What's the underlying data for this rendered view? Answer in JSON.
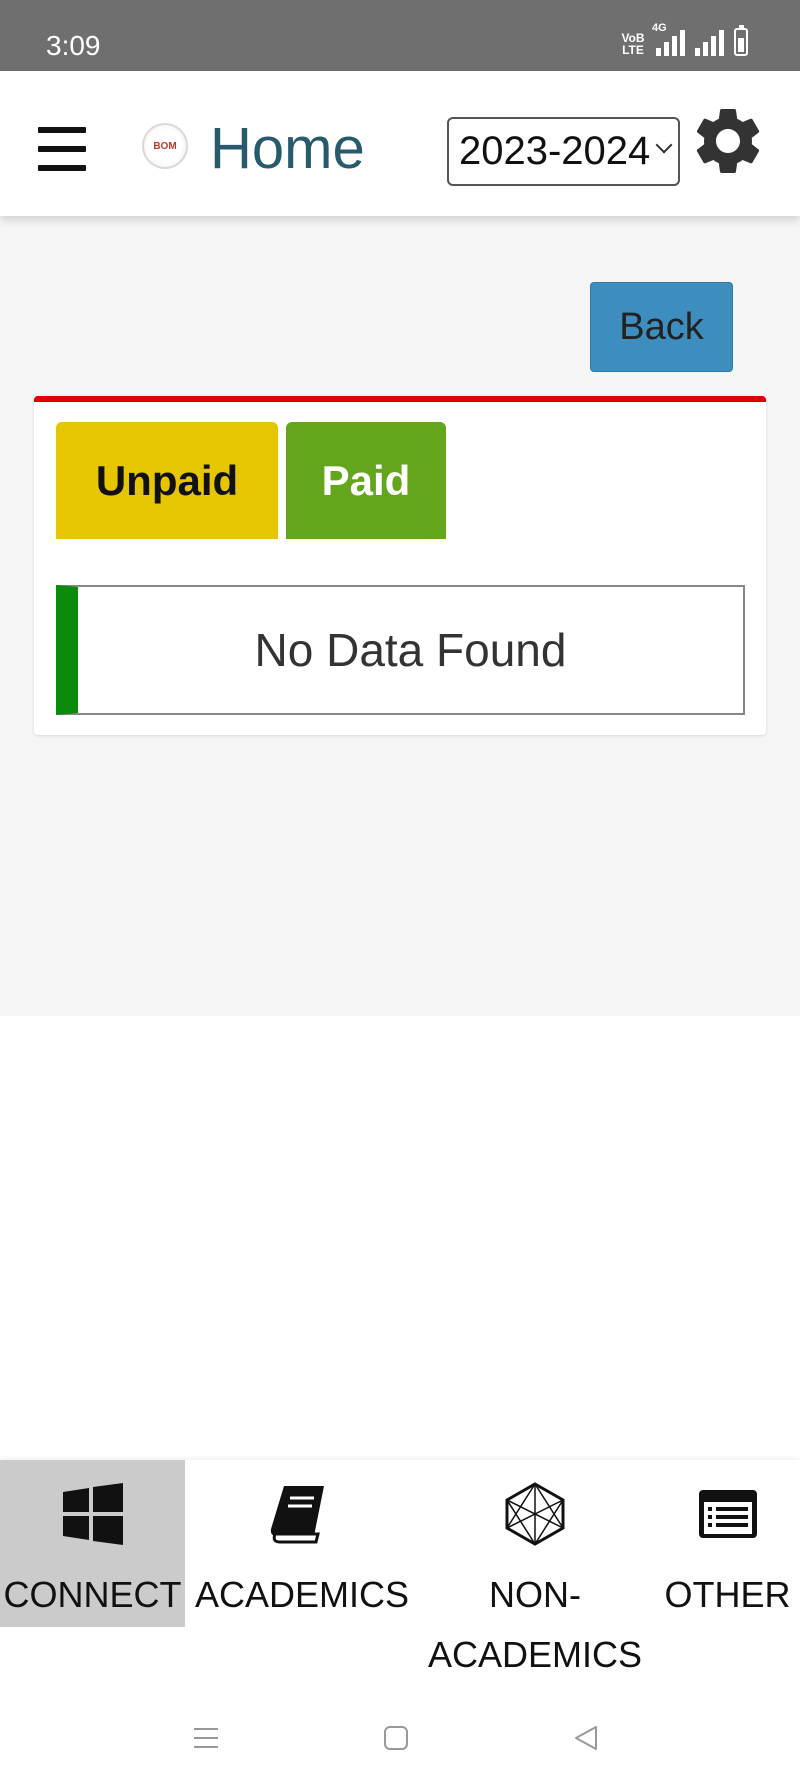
{
  "status_bar": {
    "time": "3:09",
    "volte_line1": "VoB",
    "volte_line2": "LTE",
    "network_type": "4G"
  },
  "header": {
    "logo_text": "BOM",
    "title": "Home",
    "year_selected": "2023-2024",
    "accent_color": "#285a6e"
  },
  "main": {
    "back_label": "Back",
    "tabs": [
      {
        "label": "Unpaid",
        "color": "#e6c600"
      },
      {
        "label": "Paid",
        "color": "#63a61c"
      }
    ],
    "empty_message": "No Data Found",
    "card_accent_color": "#e00000"
  },
  "bottom_nav": {
    "items": [
      {
        "label": "CONNECT",
        "icon": "windows-icon",
        "active": true
      },
      {
        "label": "ACADEMICS",
        "icon": "book-icon",
        "active": false
      },
      {
        "label": "NON-\nACADEMICS",
        "icon": "network-hexagon-icon",
        "active": false
      },
      {
        "label": "OTHER",
        "icon": "list-icon",
        "active": false
      }
    ]
  },
  "system_nav": {
    "buttons": [
      "menu-icon",
      "home-square-icon",
      "back-triangle-icon"
    ]
  }
}
